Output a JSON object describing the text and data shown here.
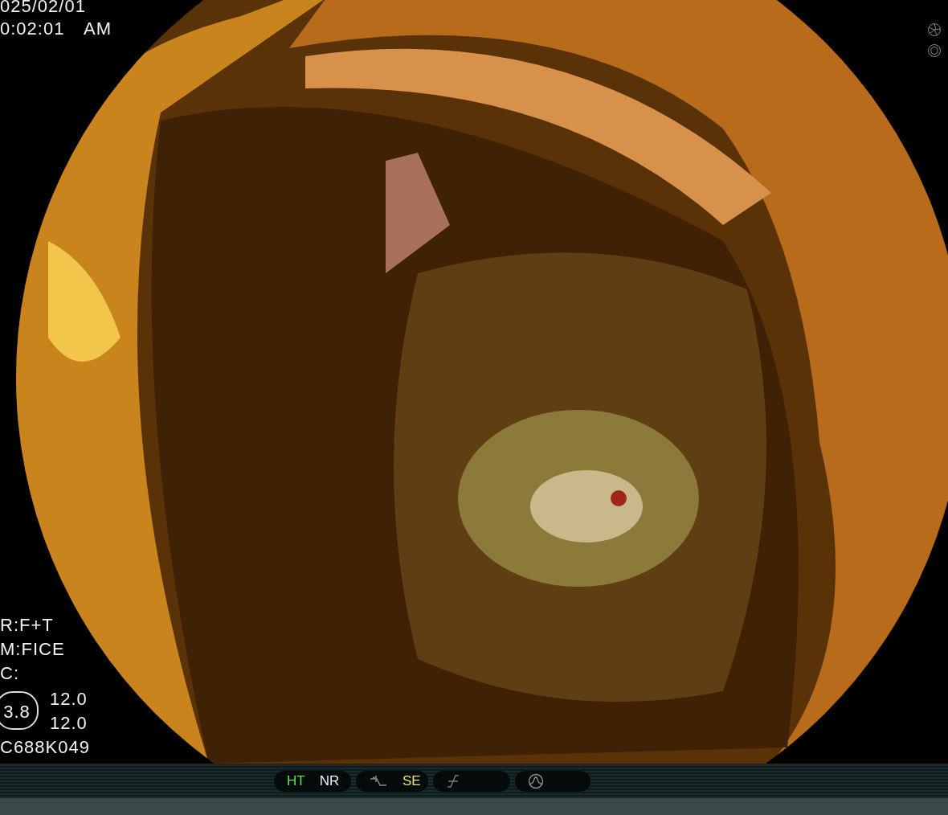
{
  "overlay": {
    "date": "025/02/01",
    "time": "0:02:01",
    "meridiem": "AM",
    "settings": [
      {
        "text": "R:F+T"
      },
      {
        "text": "M:FICE"
      },
      {
        "text": "C:"
      }
    ],
    "zoom": {
      "value": "3.8",
      "readings": [
        "12.0",
        "12.0"
      ]
    },
    "scope_id": "C688K049"
  },
  "status_bar": {
    "groups": [
      {
        "items": [
          {
            "kind": "text",
            "text": "HT",
            "color": "#66dd55"
          },
          {
            "kind": "text",
            "text": "NR",
            "color": "#f0f0f0"
          }
        ]
      },
      {
        "items": [
          {
            "kind": "curve"
          },
          {
            "kind": "text",
            "text": "SE",
            "color": "#e8e070"
          }
        ]
      },
      {
        "items": [
          {
            "kind": "slope"
          }
        ]
      },
      {
        "items": [
          {
            "kind": "peak"
          }
        ]
      }
    ]
  }
}
